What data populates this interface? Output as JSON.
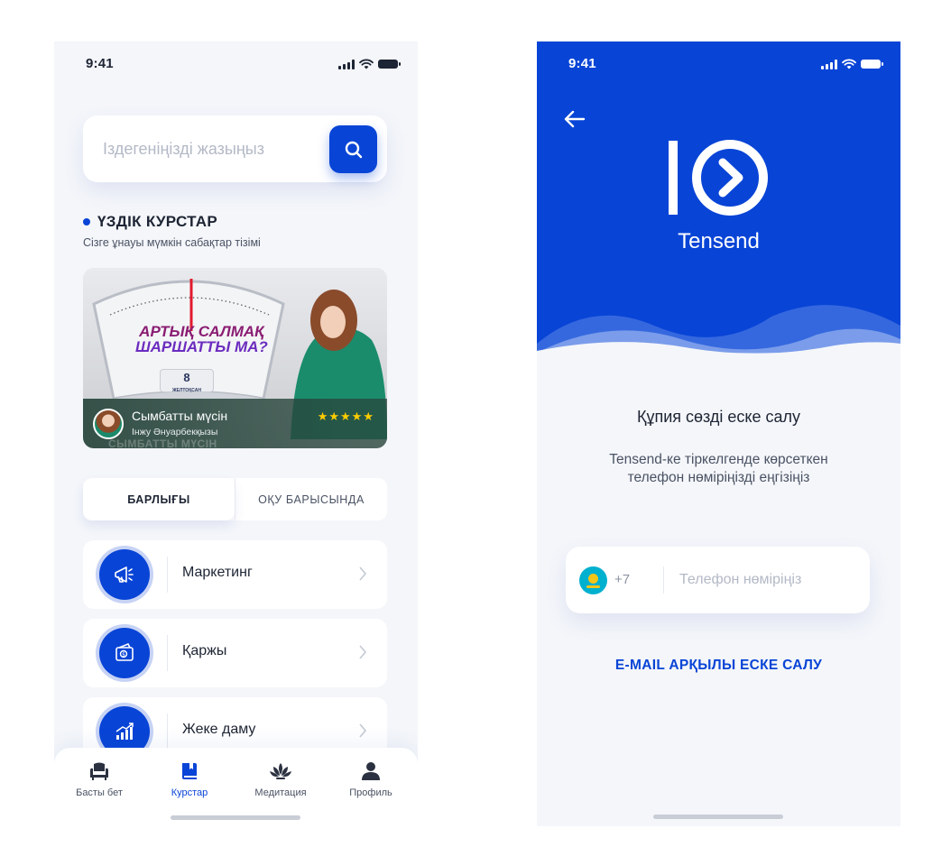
{
  "left": {
    "status": {
      "time": "9:41"
    },
    "search": {
      "placeholder": "Іздегеніңізді жазыңыз"
    },
    "section": {
      "title": "ҮЗДІК КУРСТАР",
      "subtitle": "Сізге ұнауы мүмкін сабақтар тізімі"
    },
    "banner": {
      "headline_line1": "АРТЫҚ САЛМАҚ",
      "headline_line2": "ШАРШАТТЫ МА?",
      "badge_number": "8",
      "badge_word": "ЖЕЛТОҚСАН",
      "course": "Сымбатты мүсін",
      "author": "Інжу Әнуарбекқызы",
      "ghost_text": "СЫМБАТТЫ МҮСІН",
      "stars": "★★★★★",
      "rating": 5
    },
    "tabs": [
      {
        "label": "БАРЛЫҒЫ",
        "active": true
      },
      {
        "label": "ОҚУ БАРЫСЫНДА",
        "active": false
      }
    ],
    "categories": [
      {
        "label": "Маркетинг",
        "icon": "megaphone-icon"
      },
      {
        "label": "Қаржы",
        "icon": "wallet-icon"
      },
      {
        "label": "Жеке даму",
        "icon": "growth-chart-icon"
      }
    ],
    "nav": [
      {
        "label": "Басты бет",
        "icon": "armchair-icon",
        "active": false
      },
      {
        "label": "Курстар",
        "icon": "book-icon",
        "active": true
      },
      {
        "label": "Медитация",
        "icon": "lotus-icon",
        "active": false
      },
      {
        "label": "Профиль",
        "icon": "user-icon",
        "active": false
      }
    ]
  },
  "right": {
    "status": {
      "time": "9:41"
    },
    "logo": {
      "text": "Tensend",
      "mark": "10"
    },
    "title": "Құпия сөзді еске салу",
    "description": "Tensend-ке тіркелгенде көрсеткен телефон нөміріңізді еңгізіңіз",
    "phone": {
      "code": "+7",
      "placeholder": "Телефон нөміріңіз"
    },
    "email_link": "E-MAIL АРҚЫЛЫ ЕСКЕ САЛУ"
  },
  "colors": {
    "primary": "#0844d6",
    "background": "#f4f6fa",
    "star": "#ffcc00"
  }
}
